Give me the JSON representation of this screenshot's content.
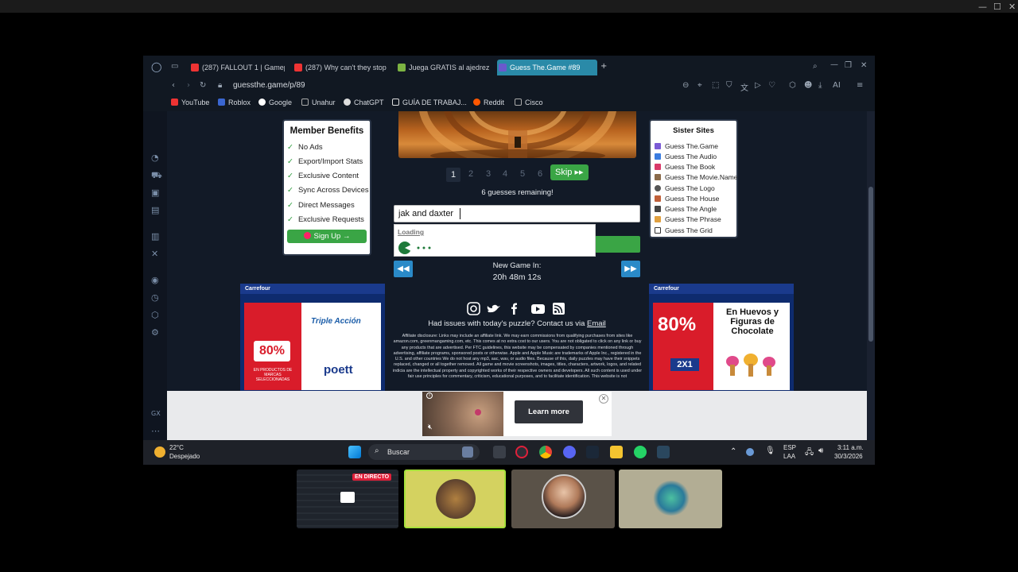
{
  "tabs": [
    {
      "label": "(287) FALLOUT 1 | Gamepl",
      "color": "#e33"
    },
    {
      "label": "(287) Why can't they stop",
      "color": "#e33"
    },
    {
      "label": "Juega GRATIS al ajedrez c",
      "color": "#7cb342"
    },
    {
      "label": "Guess The.Game #89",
      "color": "#6a5acd"
    }
  ],
  "address": {
    "url": "guessthe.game/p/89"
  },
  "bookmarks": [
    {
      "label": "YouTube",
      "color": "#e33"
    },
    {
      "label": "Roblox",
      "color": "#3a66d0"
    },
    {
      "label": "Google",
      "color": "#fff"
    },
    {
      "label": "Unahur",
      "color": "#aaa"
    },
    {
      "label": "ChatGPT",
      "color": "#ddd"
    },
    {
      "label": "GUÍA DE TRABAJ...",
      "color": "#ddd"
    },
    {
      "label": "Reddit",
      "color": "#ff5700"
    },
    {
      "label": "Cisco",
      "color": "#aaa"
    }
  ],
  "member_benefits": {
    "title": "Member Benefits",
    "items": [
      "No Ads",
      "Export/Import Stats",
      "Exclusive Content",
      "Sync Across Devices",
      "Direct Messages",
      "Exclusive Requests"
    ],
    "signup_label": "Sign Up →"
  },
  "sister_sites": {
    "title": "Sister Sites",
    "items": [
      {
        "label": "Guess The.Game",
        "color": "#7b5bd6"
      },
      {
        "label": "Guess The Audio",
        "color": "#3b7de0"
      },
      {
        "label": "Guess The Book",
        "color": "#d93a6a"
      },
      {
        "label": "Guess The Movie.Name",
        "color": "#8a6a4a"
      },
      {
        "label": "Guess The Logo",
        "color": "#555"
      },
      {
        "label": "Guess The House",
        "color": "#c0603a"
      },
      {
        "label": "Guess The Angle",
        "color": "#444"
      },
      {
        "label": "Guess The Phrase",
        "color": "#e0a040"
      },
      {
        "label": "Guess The Grid",
        "color": "#333"
      }
    ]
  },
  "game": {
    "guess_numbers": [
      "1",
      "2",
      "3",
      "4",
      "5",
      "6"
    ],
    "skip_label": "Skip ▸▸",
    "remaining": "6 guesses remaining!",
    "input_value": "jak and daxter",
    "loading": "Loading",
    "new_game_label": "New Game In:",
    "countdown": "20h 48m 12s"
  },
  "footer": {
    "issue_text": "Had issues with today's puzzle? Contact us via",
    "email_link": "Email",
    "disclosure": "Affiliate disclosure: Links may include an affiliate link. We may earn commissions from qualifying purchases from sites like amazon.com, greenmangaming.com, etc. This comes at no extra cost to our users. You are not obligated to click on any link or buy any products that are advertised. Per FTC guidelines, this website may be compensated by companies mentioned through advertising, affiliate programs, sponsored posts or otherwise. Apple and Apple Music are trademarks of Apple Inc., registered in the U.S. and other countries We do not host any mp3, aac, wav, or audio files. Because of this, daily puzzles may have their snippets replaced, changed or all together removed. All game and movie screenshots, images, titles, characters, artwork, logos, and related indicia are the intellectual property and copyrighted works of their respective owners and developers. All such content is used under fair use principles for commentary, criticism, educational purposes, and to facilitate identification. This website is not"
  },
  "ads": {
    "left": {
      "brand": "Carrefour",
      "promo": "80%",
      "tagline": "Triple Acción",
      "product": "poett",
      "footer": "EN PRODUCTOS DE MARCAS SELECCIONADAS"
    },
    "right": {
      "brand": "Carrefour",
      "promo": "80%",
      "headline": "En Huevos y Figuras de Chocolate",
      "badge": "2X1"
    },
    "bottom_cta": "Learn more"
  },
  "taskbar": {
    "temp": "22°C",
    "weather": "Despejado",
    "search_placeholder": "Buscar",
    "lang": "ESP",
    "lang2": "LAA",
    "time": "3:11 a.m.",
    "date": "30/3/2026"
  },
  "stream": {
    "live_label": "EN DIRECTO"
  }
}
